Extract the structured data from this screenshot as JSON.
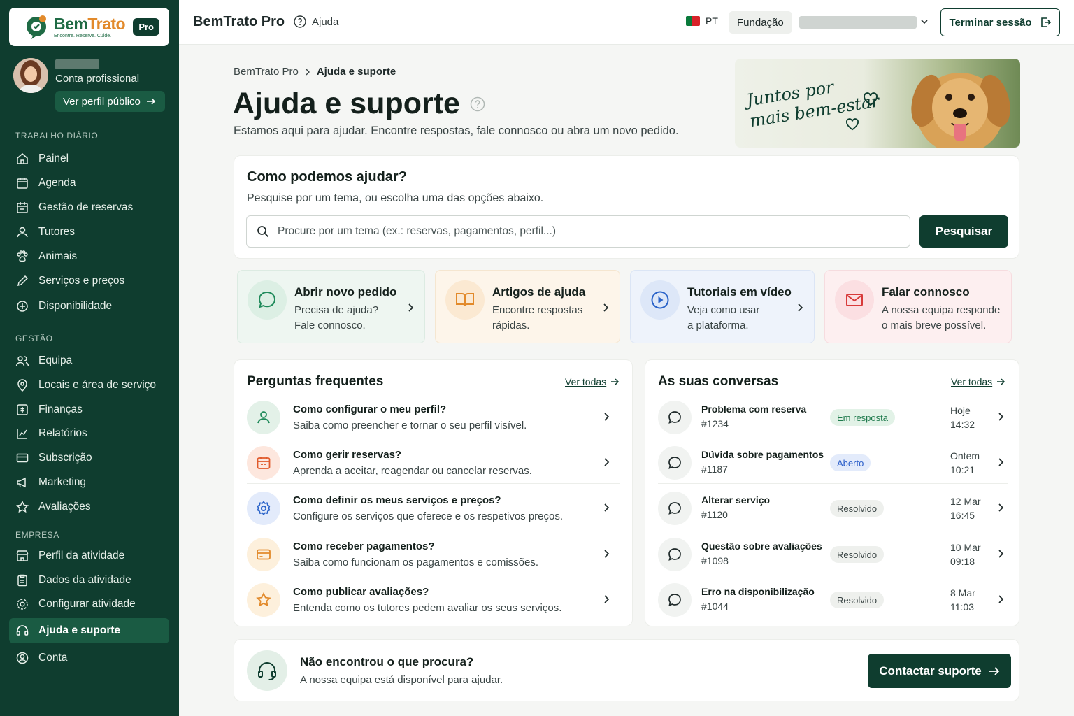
{
  "sidebar": {
    "logo": {
      "name_a": "Bem",
      "name_b": "Trato",
      "tagline": "Encontre. Reserve. Cuide.",
      "badge": "Pro"
    },
    "profile": {
      "role": "Conta profissional",
      "public_profile_button": "Ver perfil público"
    },
    "sections": [
      {
        "title": "TRABALHO DIÁRIO",
        "items": [
          {
            "label": "Painel",
            "icon": "home-icon"
          },
          {
            "label": "Agenda",
            "icon": "calendar-icon"
          },
          {
            "label": "Gestão de reservas",
            "icon": "calendar-check-icon"
          },
          {
            "label": "Tutores",
            "icon": "user-icon"
          },
          {
            "label": "Animais",
            "icon": "paw-icon"
          },
          {
            "label": "Serviços e preços",
            "icon": "pencil-icon"
          },
          {
            "label": "Disponibilidade",
            "icon": "plus-circle-icon"
          }
        ]
      },
      {
        "title": "GESTÃO",
        "items": [
          {
            "label": "Equipa",
            "icon": "users-icon"
          },
          {
            "label": "Locais e área de serviço",
            "icon": "map-pin-icon"
          },
          {
            "label": "Finanças",
            "icon": "finance-icon"
          },
          {
            "label": "Relatórios",
            "icon": "chart-icon"
          },
          {
            "label": "Subscrição",
            "icon": "card-icon"
          },
          {
            "label": "Marketing",
            "icon": "megaphone-icon"
          },
          {
            "label": "Avaliações",
            "icon": "star-icon"
          }
        ]
      },
      {
        "title": "EMPRESA",
        "items": [
          {
            "label": "Perfil da atividade",
            "icon": "store-icon"
          },
          {
            "label": "Dados da atividade",
            "icon": "clipboard-icon"
          },
          {
            "label": "Configurar atividade",
            "icon": "gear-icon"
          },
          {
            "label": "Ajuda e suporte",
            "icon": "headset-icon",
            "active": true
          },
          {
            "label": "Conta",
            "icon": "account-icon"
          }
        ]
      }
    ]
  },
  "topbar": {
    "title": "BemTrato Pro",
    "help": "Ajuda",
    "language": "PT",
    "organization": "Fundação",
    "logout": "Terminar sessão"
  },
  "breadcrumb": {
    "root": "BemTrato Pro",
    "current": "Ajuda e suporte"
  },
  "page": {
    "title": "Ajuda e suporte",
    "subtitle": "Estamos aqui para ajudar. Encontre respostas, fale connosco ou abra um novo pedido."
  },
  "banner": {
    "line1": "Juntos por",
    "line2": "mais bem-estar"
  },
  "search": {
    "title": "Como podemos ajudar?",
    "subtitle": "Pesquise por um tema, ou escolha uma das opções abaixo.",
    "placeholder": "Procure por um tema (ex.: reservas, pagamentos, perfil...)",
    "button": "Pesquisar"
  },
  "options": [
    {
      "title": "Abrir novo pedido",
      "line1": "Precisa de ajuda?",
      "line2": "Fale connosco.",
      "icon": "chat-icon",
      "color": "#1f8a5a"
    },
    {
      "title": "Artigos de ajuda",
      "line1": "Encontre respostas",
      "line2": "rápidas.",
      "icon": "book-icon",
      "color": "#e28a2b"
    },
    {
      "title": "Tutoriais em vídeo",
      "line1": "Veja como usar",
      "line2": "a plataforma.",
      "icon": "play-icon",
      "color": "#2a63c9"
    },
    {
      "title": "Falar connosco",
      "line1": "A nossa equipa responde",
      "line2": "o mais breve possível.",
      "icon": "mail-icon",
      "color": "#d83a3a"
    }
  ],
  "faq": {
    "title": "Perguntas frequentes",
    "view_all": "Ver todas",
    "items": [
      {
        "q": "Como configurar o meu perfil?",
        "a": "Saiba como preencher e tornar o seu perfil visível.",
        "icon": "user-icon",
        "color": "#1f8a5a"
      },
      {
        "q": "Como gerir reservas?",
        "a": "Aprenda a aceitar, reagendar ou cancelar reservas.",
        "icon": "calendar-icon",
        "color": "#e05a2b"
      },
      {
        "q": "Como definir os meus serviços e preços?",
        "a": "Configure os serviços que oferece e os respetivos preços.",
        "icon": "gear-icon",
        "color": "#2a63c9"
      },
      {
        "q": "Como receber pagamentos?",
        "a": "Saiba como funcionam os pagamentos e comissões.",
        "icon": "card-icon",
        "color": "#e28a2b"
      },
      {
        "q": "Como publicar avaliações?",
        "a": "Entenda como os tutores pedem avaliar os seus serviços.",
        "icon": "star-icon",
        "color": "#e28a2b"
      }
    ]
  },
  "conversations": {
    "title": "As suas conversas",
    "view_all": "Ver todas",
    "items": [
      {
        "subject": "Problema com reserva",
        "id": "#1234",
        "status": "Em resposta",
        "status_color": "#1f7a4d",
        "status_bg": "#e2f2e7",
        "date": "Hoje",
        "time": "14:32"
      },
      {
        "subject": "Dúvida sobre pagamentos",
        "id": "#1187",
        "status": "Aberto",
        "status_color": "#2a5ec9",
        "status_bg": "#e3ebfb",
        "date": "Ontem",
        "time": "10:21"
      },
      {
        "subject": "Alterar serviço",
        "id": "#1120",
        "status": "Resolvido",
        "status_color": "#3a4545",
        "status_bg": "#eef0ed",
        "date": "12 Mar",
        "time": "16:45"
      },
      {
        "subject": "Questão sobre avaliações",
        "id": "#1098",
        "status": "Resolvido",
        "status_color": "#3a4545",
        "status_bg": "#eef0ed",
        "date": "10 Mar",
        "time": "09:18"
      },
      {
        "subject": "Erro na disponibilização",
        "id": "#1044",
        "status": "Resolvido",
        "status_color": "#3a4545",
        "status_bg": "#eef0ed",
        "date": "8 Mar",
        "time": "11:03"
      }
    ]
  },
  "support": {
    "title": "Não encontrou o que procura?",
    "subtitle": "A nossa equipa está disponível para ajudar.",
    "button": "Contactar suporte"
  }
}
